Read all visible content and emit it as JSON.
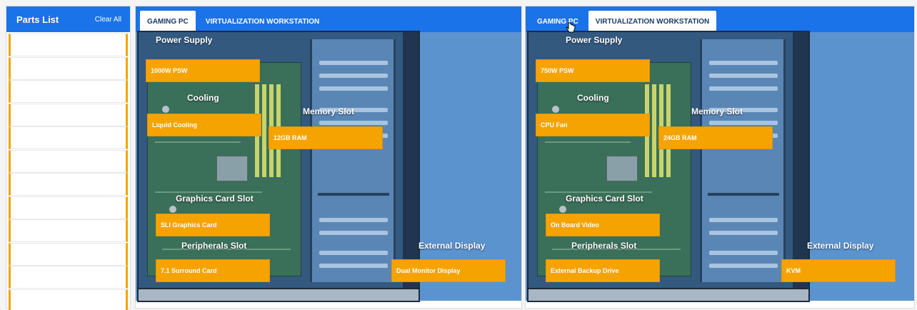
{
  "sidebar": {
    "title": "Parts List",
    "clear_all": "Clear All",
    "slot_count": 12
  },
  "panels": [
    {
      "tabs": [
        {
          "label": "GAMING PC",
          "active": true
        },
        {
          "label": "VIRTUALIZATION WORKSTATION",
          "active": false
        }
      ],
      "slots": {
        "power_supply": {
          "label": "Power Supply",
          "part": "1000W PSW"
        },
        "cooling": {
          "label": "Cooling",
          "part": "Liquid Cooling"
        },
        "memory": {
          "label": "Memory Slot",
          "part": "12GB RAM"
        },
        "graphics": {
          "label": "Graphics Card Slot",
          "part": "SLI Graphics Card"
        },
        "peripherals": {
          "label": "Peripherals Slot",
          "part": "7.1 Surround Card"
        },
        "display": {
          "label": "External Display",
          "part": "Dual Monitor Display"
        }
      }
    },
    {
      "tabs": [
        {
          "label": "GAMING PC",
          "active": false
        },
        {
          "label": "VIRTUALIZATION WORKSTATION",
          "active": true
        }
      ],
      "slots": {
        "power_supply": {
          "label": "Power Supply",
          "part": "750W PSW"
        },
        "cooling": {
          "label": "Cooling",
          "part": "CPU Fan"
        },
        "memory": {
          "label": "Memory Slot",
          "part": "24GB RAM"
        },
        "graphics": {
          "label": "Graphics Card Slot",
          "part": "On Board Video"
        },
        "peripherals": {
          "label": "Peripherals Slot",
          "part": "External Backup Drive"
        },
        "display": {
          "label": "External Display",
          "part": "KVM"
        }
      }
    }
  ],
  "colors": {
    "accent": "#1a73e8",
    "part": "#f5a300",
    "case_background": "#5b93cf"
  }
}
